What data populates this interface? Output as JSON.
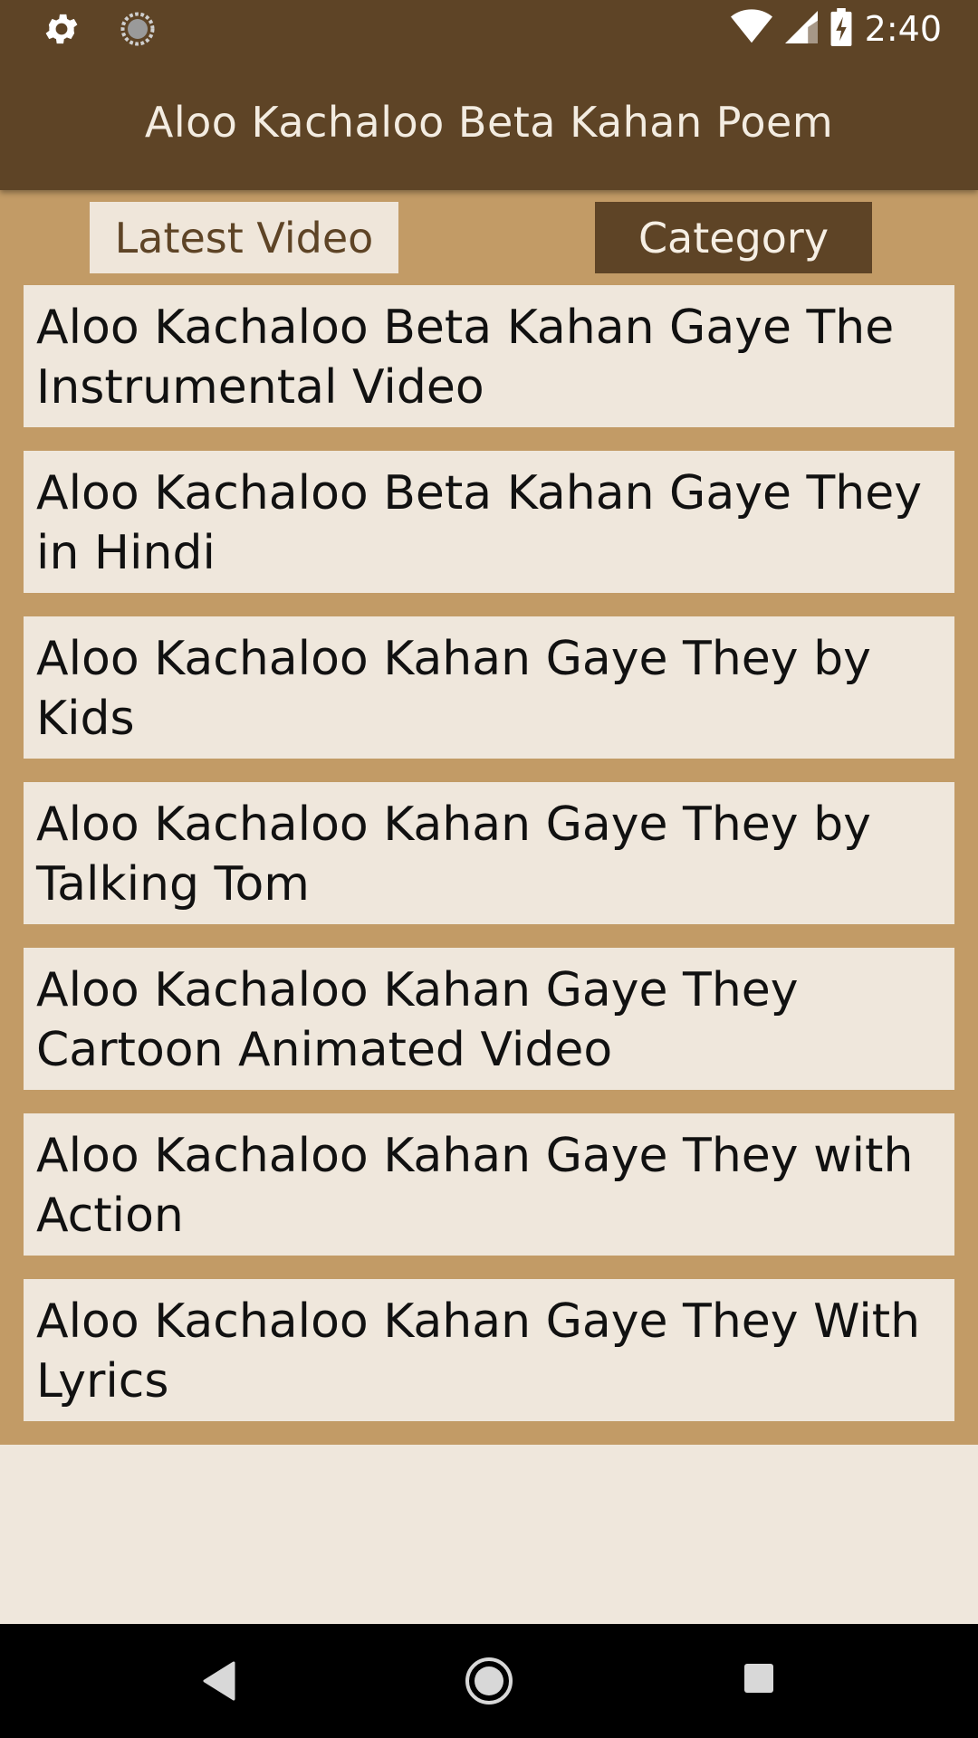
{
  "status_bar": {
    "time": "2:40",
    "icons": [
      "settings-icon",
      "sync-icon",
      "wifi-icon",
      "signal-icon",
      "battery-charging-icon"
    ]
  },
  "app_bar": {
    "title": "Aloo Kachaloo Beta Kahan Poem"
  },
  "tabs": [
    {
      "label": "Latest Video",
      "selected": true
    },
    {
      "label": "Category",
      "selected": false
    }
  ],
  "videos": [
    {
      "title": "Aloo Kachaloo Beta Kahan Gaye The Instrumental Video"
    },
    {
      "title": "Aloo Kachaloo Beta Kahan Gaye They in Hindi"
    },
    {
      "title": "Aloo Kachaloo Kahan Gaye They by Kids"
    },
    {
      "title": "Aloo Kachaloo Kahan Gaye They by Talking Tom"
    },
    {
      "title": "Aloo Kachaloo Kahan Gaye They Cartoon Animated Video"
    },
    {
      "title": "Aloo Kachaloo Kahan Gaye They with Action"
    },
    {
      "title": "Aloo Kachaloo Kahan Gaye They With Lyrics"
    }
  ],
  "nav_bar": {
    "buttons": [
      "back-icon",
      "home-icon",
      "recents-icon"
    ]
  },
  "colors": {
    "primary_dark": "#5e4426",
    "content_bg": "#c29b66",
    "item_bg": "#efe7dc"
  }
}
